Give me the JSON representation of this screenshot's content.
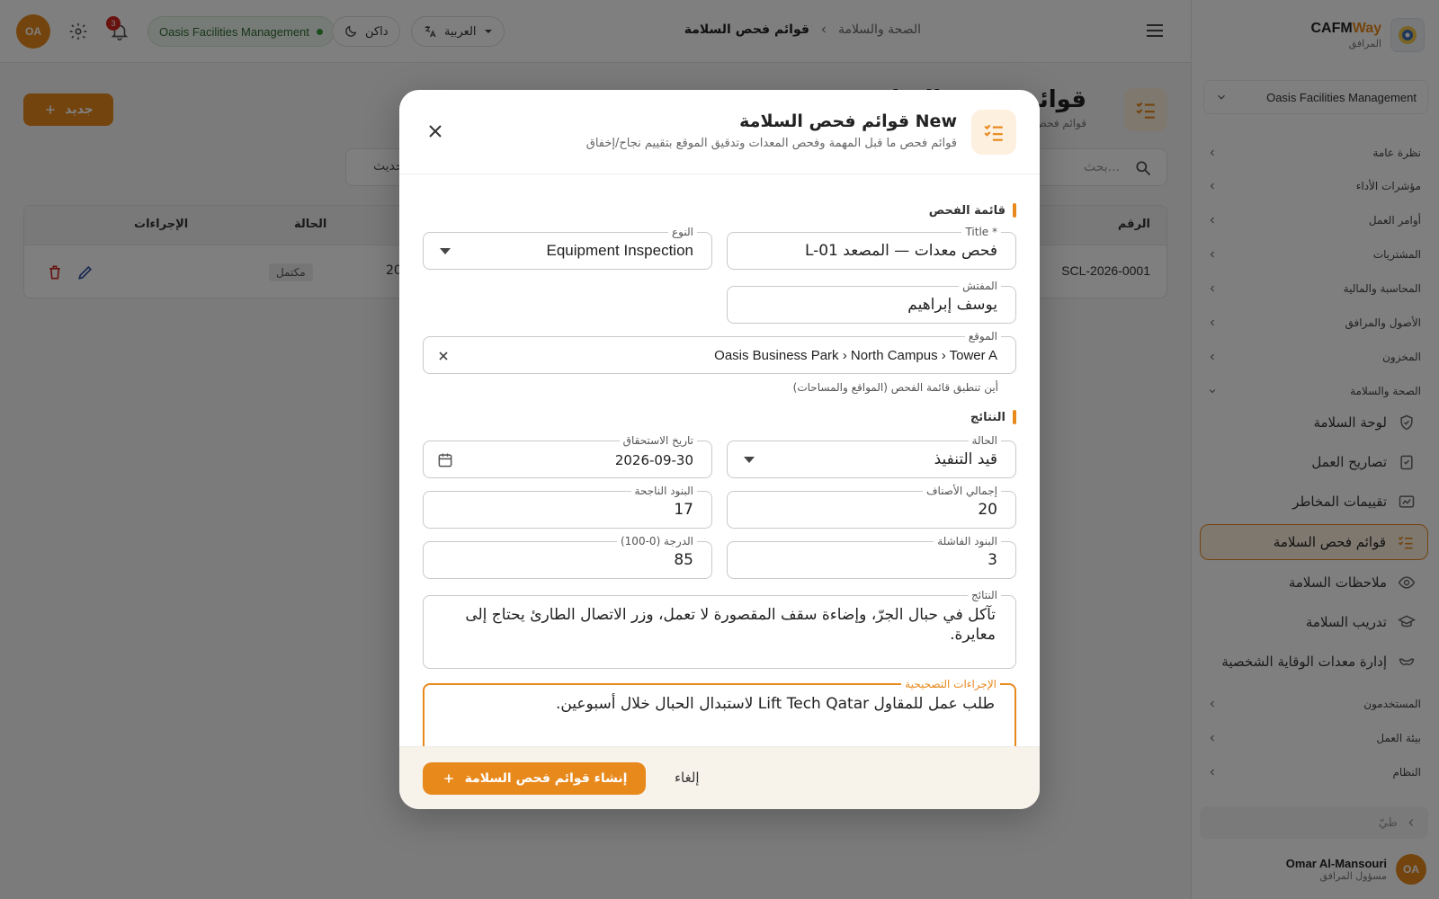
{
  "brand": {
    "name_main": "CAFM",
    "name_accent": "Way",
    "subtitle": "المرافق"
  },
  "sidebar": {
    "org": "Oasis Facilities Management",
    "groups": [
      {
        "label": "نظرة عامة"
      },
      {
        "label": "مؤشرات الأداء"
      },
      {
        "label": "أوامر العمل"
      },
      {
        "label": "المشتريات"
      },
      {
        "label": "المحاسبة والمالية"
      },
      {
        "label": "الأصول والمرافق"
      },
      {
        "label": "المخزون"
      },
      {
        "label": "الصحة والسلامة"
      },
      {
        "label": "المستخدمون"
      },
      {
        "label": "بيئة العمل"
      },
      {
        "label": "النظام"
      }
    ],
    "safety_items": [
      {
        "label": "لوحة السلامة",
        "icon": "shield-icon"
      },
      {
        "label": "تصاريح العمل",
        "icon": "clipboard-check-icon"
      },
      {
        "label": "تقييمات المخاطر",
        "icon": "risk-card-icon"
      },
      {
        "label": "قوائم فحص السلامة",
        "icon": "checklist-icon"
      },
      {
        "label": "ملاحظات السلامة",
        "icon": "eye-icon"
      },
      {
        "label": "تدريب السلامة",
        "icon": "graduation-cap-icon"
      },
      {
        "label": "إدارة معدات الوقاية الشخصية",
        "icon": "ppe-icon"
      }
    ],
    "collapse_label": "طيّ",
    "user": {
      "initials": "OA",
      "name": "Omar Al-Mansouri",
      "role": "مسؤول المرافق"
    }
  },
  "topbar": {
    "avatar_initials": "OA",
    "notif_count": "3",
    "org_pill": "Oasis Facilities Management",
    "theme_label": "داكن",
    "lang_label": "العربية",
    "breadcrumb": {
      "parent": "الصحة والسلامة",
      "current": "قوائم فحص السلامة"
    }
  },
  "page": {
    "title": "قوائم فحص السلامة",
    "subtitle": "قوائم فحص ما قبل المهمة وفحص المعدات",
    "new_label": "جديد",
    "search_placeholder": "بحث...",
    "refresh_label": "تحديث",
    "table": {
      "col_number": "الرقم",
      "col_status": "الحالة",
      "col_actions": "الإجراءات",
      "rows": [
        {
          "number": "SCL-2026-0001",
          "date_partial": "20",
          "status": "مكتمل"
        }
      ]
    }
  },
  "modal": {
    "title": "New قوائم فحص السلامة",
    "subtitle": "قوائم فحص ما قبل المهمة وفحص المعدات وتدقيق الموقع بتقييم نجاح/إخفاق",
    "section_checklist": "قائمة الفحص",
    "section_results": "النتائج",
    "fields": {
      "title_label": "Title *",
      "title_value": "فحص معدات — المصعد L-01",
      "type_label": "النوع",
      "type_value": "Equipment Inspection",
      "inspector_label": "المفتش",
      "inspector_value": "يوسف إبراهيم",
      "location_label": "الموقع",
      "location_value": "Oasis Business Park › North Campus › Tower A",
      "location_help": "أين تنطبق قائمة الفحص (المواقع والمساحات)",
      "status_label": "الحالة",
      "status_value": "قيد التنفيذ",
      "due_label": "تاريخ الاستحقاق",
      "due_value": "2026-09-30",
      "total_label": "إجمالي الأصناف",
      "total_value": "20",
      "passed_label": "البنود الناجحة",
      "passed_value": "17",
      "failed_label": "البنود الفاشلة",
      "failed_value": "3",
      "score_label": "الدرجة (0-100)",
      "score_value": "85",
      "findings_label": "النتائج",
      "findings_value": "تآكل في حبال الجرّ، وإضاءة سقف المقصورة لا تعمل، وزر الاتصال الطارئ يحتاج إلى معايرة.",
      "corrective_label": "الإجراءات التصحيحية",
      "corrective_value": "طلب عمل للمقاول Lift Tech Qatar لاستبدال الحبال خلال أسبوعين."
    },
    "cancel_label": "إلغاء",
    "create_label": "إنشاء قوائم فحص السلامة"
  },
  "colors": {
    "accent": "#e8891c",
    "accent_soft": "#fdf0df",
    "danger": "#d0271f",
    "success": "#3a9a3e"
  }
}
